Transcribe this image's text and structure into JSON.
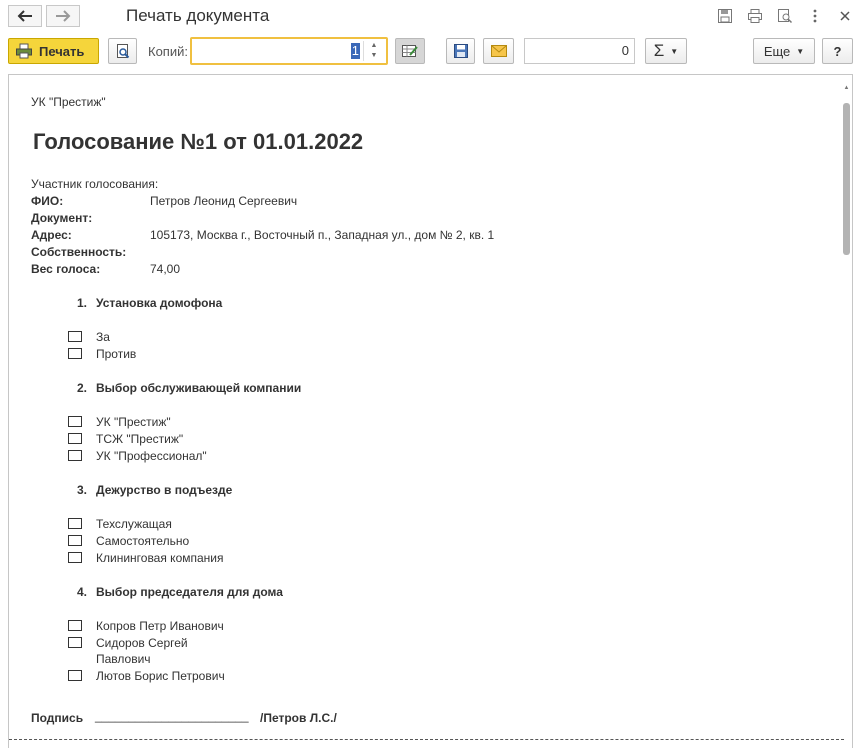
{
  "window": {
    "title": "Печать документа"
  },
  "toolbar": {
    "print_label": "Печать",
    "copies_label": "Копий:",
    "copies_value": "1",
    "sum_value": "0",
    "sum_symbol": "Σ",
    "more_label": "Еще",
    "help_label": "?"
  },
  "document": {
    "org": "УК \"Престиж\"",
    "title": "Голосование №1 от 01.01.2022",
    "participant_caption": "Участник голосования:",
    "fields": [
      {
        "label": "ФИО:",
        "value": "Петров Леонид Сергеевич"
      },
      {
        "label": "Документ:",
        "value": ""
      },
      {
        "label": "Адрес:",
        "value": "105173, Москва г., Восточный п., Западная ул., дом № 2, кв. 1"
      },
      {
        "label": "Собственность:",
        "value": ""
      },
      {
        "label": "Вес голоса:",
        "value": "74,00"
      }
    ],
    "questions": [
      {
        "number": "1.",
        "title": "Установка домофона",
        "options": [
          "За",
          "Против"
        ]
      },
      {
        "number": "2.",
        "title": "Выбор обслуживающей компании",
        "options": [
          "УК \"Престиж\"",
          "ТСЖ \"Престиж\"",
          "УК \"Профессионал\""
        ]
      },
      {
        "number": "3.",
        "title": "Дежурство в подъезде",
        "options": [
          "Техслужащая",
          "Самостоятельно",
          "Клининговая компания"
        ]
      },
      {
        "number": "4.",
        "title": "Выбор председателя для дома",
        "options": [
          "Копров Петр Иванович",
          "Сидоров Сергей",
          "Лютов Борис Петрович"
        ],
        "option_continuation": "Павлович"
      }
    ],
    "signature": {
      "label": "Подпись",
      "line": "_______________________",
      "name": "/Петров Л.С./"
    }
  },
  "colors": {
    "print_button": "#f5d53b",
    "copies_focus": "#f0c040",
    "selection": "#3a68b8"
  }
}
